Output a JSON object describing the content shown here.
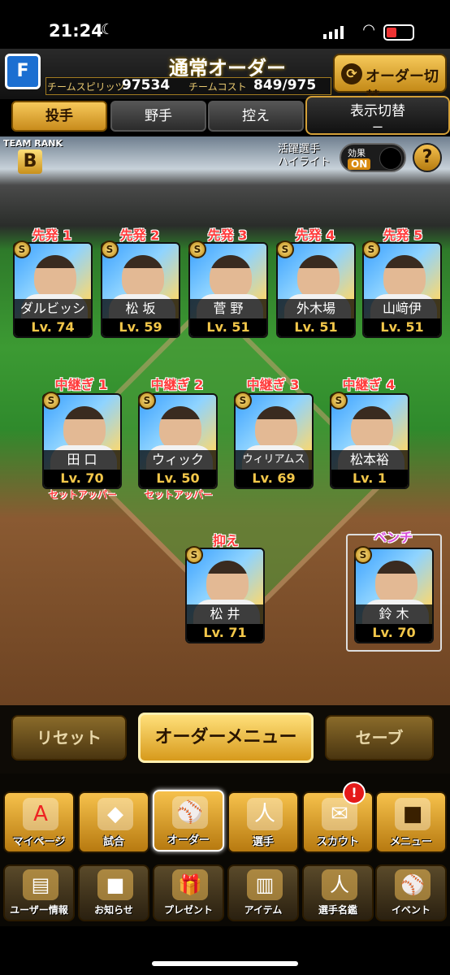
{
  "status": {
    "time": "21:24"
  },
  "header": {
    "logo": "F",
    "title": "通常オーダー",
    "spirit_label": "チームスピリッツ",
    "spirit_value": "97534",
    "cost_label": "チームコスト",
    "cost_value": "849/975",
    "switch_label": "オーダー切替"
  },
  "tabs": [
    {
      "label": "投手",
      "active": true
    },
    {
      "label": "野手",
      "active": false
    },
    {
      "label": "控え",
      "active": false
    }
  ],
  "display_toggle": {
    "label": "表示切替",
    "value": "ー"
  },
  "team_rank": {
    "label": "TEAM RANK",
    "value": "B"
  },
  "highlight": {
    "label_line1": "活躍選手",
    "label_line2": "ハイライト",
    "effect_label": "効果",
    "effect_state": "ON",
    "help": "?"
  },
  "starters": [
    {
      "slot": "先発 1",
      "name": "ダルビッシュ",
      "lv": "Lv. 74"
    },
    {
      "slot": "先発 2",
      "name": "松 坂",
      "lv": "Lv. 59"
    },
    {
      "slot": "先発 3",
      "name": "菅 野",
      "lv": "Lv. 51"
    },
    {
      "slot": "先発 4",
      "name": "外木場",
      "lv": "Lv. 51"
    },
    {
      "slot": "先発 5",
      "name": "山﨑伊",
      "lv": "Lv. 51"
    }
  ],
  "relievers": [
    {
      "slot": "中継ぎ 1",
      "name": "田 口",
      "lv": "Lv. 70",
      "role": "セットアッパー"
    },
    {
      "slot": "中継ぎ 2",
      "name": "ウィック",
      "lv": "Lv. 50",
      "role": "セットアッパー"
    },
    {
      "slot": "中継ぎ 3",
      "name": "ウィリアムス",
      "lv": "Lv. 69",
      "role": ""
    },
    {
      "slot": "中継ぎ 4",
      "name": "松本裕",
      "lv": "Lv. 1",
      "role": ""
    }
  ],
  "closer": {
    "slot": "抑え",
    "name": "松 井",
    "lv": "Lv. 71"
  },
  "bench": {
    "slot": "ベンチ",
    "name": "鈴 木",
    "lv": "Lv. 70"
  },
  "actions": {
    "reset": "リセット",
    "menu": "オーダーメニュー",
    "save": "セーブ"
  },
  "nav": [
    {
      "label": "マイページ",
      "icon": "A"
    },
    {
      "label": "試合",
      "icon": "◆"
    },
    {
      "label": "オーダー",
      "icon": "⚾"
    },
    {
      "label": "選手",
      "icon": "人"
    },
    {
      "label": "スカウト",
      "icon": "✉"
    },
    {
      "label": "メニュー",
      "icon": "■"
    }
  ],
  "scout_badge": "!",
  "nav2": [
    {
      "label": "ユーザー情報",
      "icon": "▤"
    },
    {
      "label": "お知らせ",
      "icon": "■"
    },
    {
      "label": "プレゼント",
      "icon": "🎁"
    },
    {
      "label": "アイテム",
      "icon": "▥"
    },
    {
      "label": "選手名鑑",
      "icon": "人"
    },
    {
      "label": "イベント",
      "icon": "⚾"
    }
  ],
  "colors": {
    "gold": "#f3c74a",
    "red": "#ff3a3a",
    "accent": "#d79a1c"
  }
}
